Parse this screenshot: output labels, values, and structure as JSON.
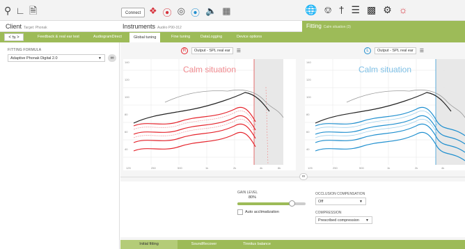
{
  "topbar": {
    "connect_label": "Connect",
    "left_icons": [
      "person-icon",
      "audiogram-icon",
      "document-icon"
    ],
    "right_icons": [
      "globe-icon",
      "glasses-icon",
      "pen-icon",
      "equalizer-icon",
      "bars-icon",
      "wrench-icon",
      "ear-icon"
    ]
  },
  "sections": {
    "client_label": "Client",
    "client_sub": "Target: Phonak",
    "instruments_label": "Instruments",
    "instruments_sub": "Audéo P90-312",
    "fitting_label": "Fitting",
    "fitting_sub": "Calm situation (3)"
  },
  "tabs": [
    {
      "label": "Feedback & real ear test"
    },
    {
      "label": "AudiogramDirect"
    },
    {
      "label": "Global tuning"
    },
    {
      "label": "Fine tuning"
    },
    {
      "label": "DataLogging"
    },
    {
      "label": "Device options"
    }
  ],
  "nav_arrows": "< ⇆ >",
  "fitting_formula": {
    "label": "FITTING FORMULA",
    "value": "Adaptive Phonak Digital 2.0"
  },
  "left_graph": {
    "output_label": "Output - SPL real ear",
    "title": "Calm situation",
    "color": "#e5232b",
    "badge": "R"
  },
  "right_graph": {
    "output_label": "Output - SPL real ear",
    "title": "Calm situation",
    "color": "#1f8fcf",
    "badge": "L"
  },
  "axis": {
    "y_ticks": [
      "140",
      "120",
      "100",
      "80",
      "60",
      "40"
    ],
    "x_ticks": [
      "125",
      "250",
      "500",
      "1k",
      "2k",
      "4k",
      "8k"
    ]
  },
  "gain": {
    "label": "GAIN LEVEL",
    "value": "80%",
    "level": 0.8,
    "auto_label": "Auto acclimatization"
  },
  "occlusion": {
    "label": "OCCLUSION COMPENSATION",
    "value": "Off"
  },
  "compression": {
    "label": "COMPRESSION",
    "value": "Prescribed compression"
  },
  "bottom_tabs": [
    {
      "label": "Initial fitting"
    },
    {
      "label": "SoundRecover"
    },
    {
      "label": "Tinnitus balance"
    }
  ]
}
